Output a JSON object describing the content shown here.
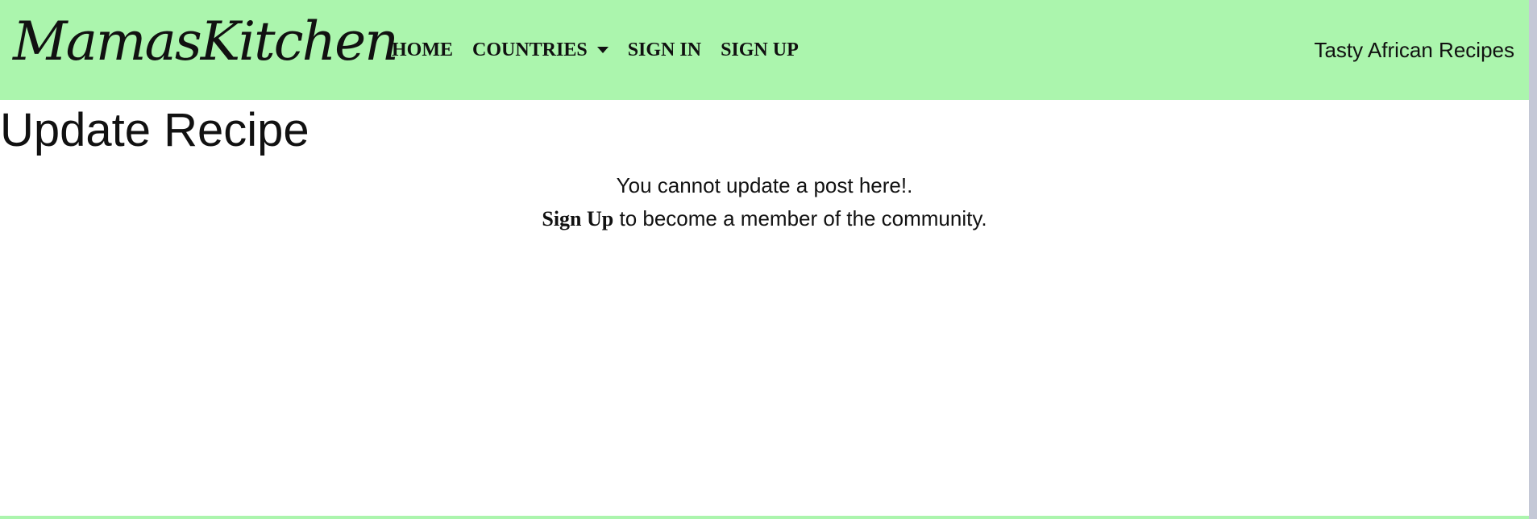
{
  "header": {
    "brand": "MamasKitchen",
    "nav": {
      "home": "HOME",
      "countries": "COUNTRIES",
      "sign_in": "SIGN IN",
      "sign_up": "SIGN UP"
    },
    "tagline": "Tasty African Recipes",
    "background_color": "#abf5ad"
  },
  "main": {
    "title": "Update Recipe",
    "message_line1": "You cannot update a post here!.",
    "signup_link": "Sign Up",
    "message_line2_suffix": " to become a member of the community."
  },
  "icons": {
    "countries_dropdown": "caret-down-icon"
  }
}
